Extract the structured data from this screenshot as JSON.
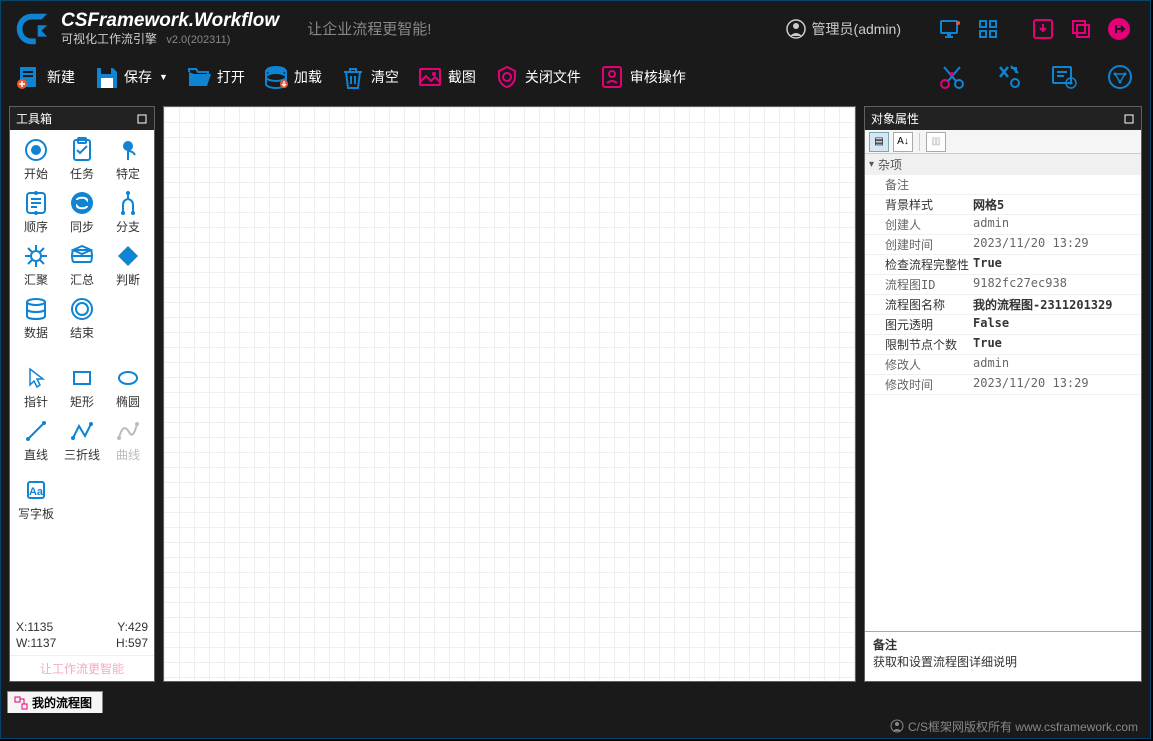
{
  "header": {
    "title": "CSFramework.Workflow",
    "subtitle": "可视化工作流引擎",
    "version": "v2.0(202311)",
    "tagline": "让企业流程更智能!",
    "user": "管理员(admin)"
  },
  "toolbar": {
    "new": "新建",
    "save": "保存",
    "open": "打开",
    "load": "加载",
    "clear": "清空",
    "screenshot": "截图",
    "close_file": "关闭文件",
    "audit": "审核操作"
  },
  "toolbox": {
    "title": "工具箱",
    "items_row1": [
      {
        "label": "开始"
      },
      {
        "label": "任务"
      },
      {
        "label": "特定"
      }
    ],
    "items_row2": [
      {
        "label": "顺序"
      },
      {
        "label": "同步"
      },
      {
        "label": "分支"
      }
    ],
    "items_row3": [
      {
        "label": "汇聚"
      },
      {
        "label": "汇总"
      },
      {
        "label": "判断"
      }
    ],
    "items_row4": [
      {
        "label": "数据"
      },
      {
        "label": "结束"
      }
    ],
    "items_row5": [
      {
        "label": "指针"
      },
      {
        "label": "矩形"
      },
      {
        "label": "椭圆"
      }
    ],
    "items_row6": [
      {
        "label": "直线"
      },
      {
        "label": "三折线"
      },
      {
        "label": "曲线"
      }
    ],
    "items_row7": [
      {
        "label": "写字板"
      }
    ],
    "coords": {
      "x": "X:1135",
      "y": "Y:429",
      "w": "W:1137",
      "h": "H:597"
    },
    "footer": "让工作流更智能"
  },
  "props": {
    "title": "对象属性",
    "category": "杂项",
    "rows": [
      {
        "name": "备注",
        "value": "",
        "light": true
      },
      {
        "name": "背景样式",
        "value": "网格5",
        "bold": true
      },
      {
        "name": "创建人",
        "value": "admin",
        "light": true
      },
      {
        "name": "创建时间",
        "value": "2023/11/20 13:29",
        "light": true
      },
      {
        "name": "检查流程完整性",
        "value": "True",
        "bold": true
      },
      {
        "name": "流程图ID",
        "value": "9182fc27ec938",
        "light": true
      },
      {
        "name": "流程图名称",
        "value": "我的流程图-2311201329",
        "bold": true
      },
      {
        "name": "图元透明",
        "value": "False",
        "bold": true
      },
      {
        "name": "限制节点个数",
        "value": "True",
        "bold": true
      },
      {
        "name": "修改人",
        "value": "admin",
        "light": true
      },
      {
        "name": "修改时间",
        "value": "2023/11/20 13:29",
        "light": true
      }
    ],
    "desc_title": "备注",
    "desc_text": "获取和设置流程图详细说明"
  },
  "tab": {
    "label": "我的流程图"
  },
  "status": {
    "text": "C/S框架网版权所有 www.csframework.com"
  }
}
